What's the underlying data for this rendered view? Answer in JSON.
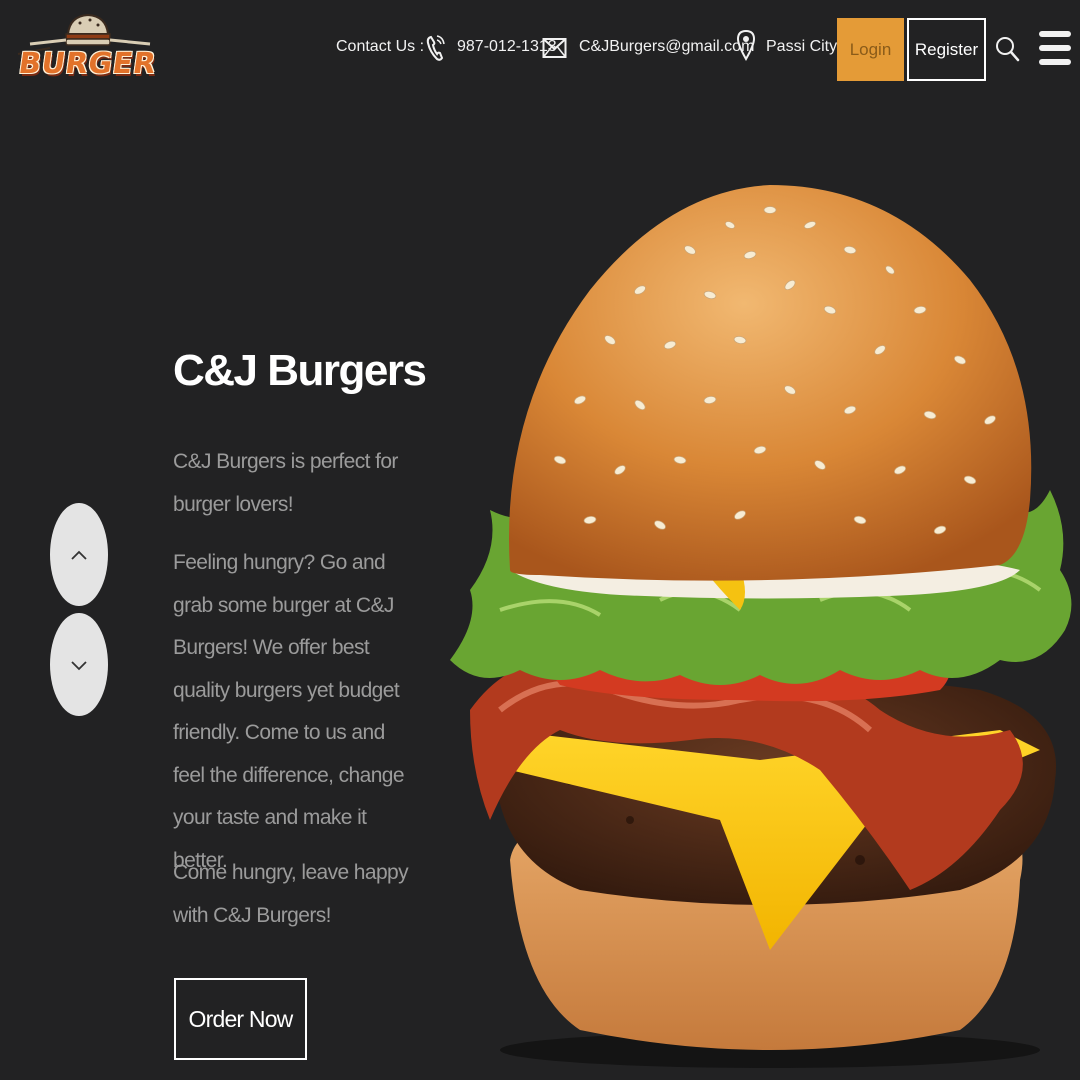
{
  "header": {
    "logo_text": "BURGER",
    "contact_label": "Contact Us :",
    "phone": "987-012-1313",
    "email": "C&JBurgers@gmail.com",
    "city": "Passi City",
    "login_label": "Login",
    "register_label": "Register"
  },
  "hero": {
    "title": "C&J Burgers",
    "paragraph_1": "C&J Burgers is perfect for burger lovers!",
    "paragraph_2": "Feeling hungry? Go and grab some burger at C&J Burgers! We offer best quality burgers yet budget friendly. Come to us and feel the difference, change your taste and make it better.",
    "paragraph_3": "Come hungry, leave happy with C&J Burgers!",
    "order_label": "Order Now"
  },
  "icons": {
    "phone": "phone-icon",
    "mail": "mail-icon",
    "location": "location-pin-icon",
    "search": "search-icon",
    "menu": "hamburger-menu-icon",
    "slide_up": "chevron-up-icon",
    "slide_down": "chevron-down-icon"
  },
  "colors": {
    "background": "#222223",
    "accent": "#e49b37",
    "muted_text": "#9b9b9b",
    "logo_orange": "#e2722a"
  }
}
